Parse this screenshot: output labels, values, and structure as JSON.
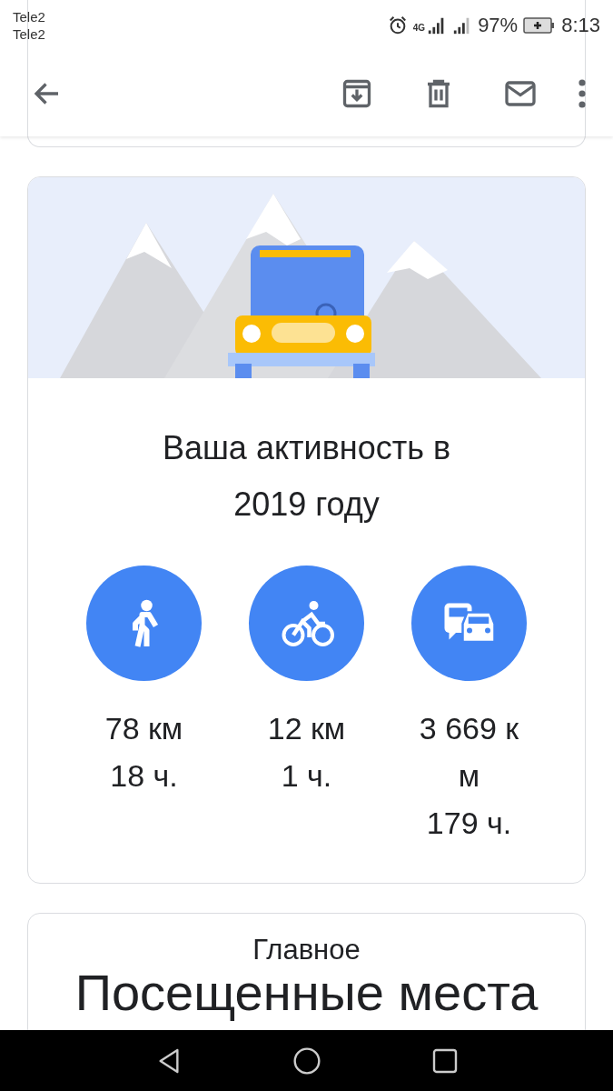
{
  "status_bar": {
    "carriers": [
      "Tele2",
      "Tele2"
    ],
    "network": "4G",
    "battery": "97%",
    "time": "8:13"
  },
  "activity_card": {
    "title": "Ваша активность в 2019 году",
    "stats": [
      {
        "kind": "walking",
        "distance": "78 км",
        "duration": "18 ч."
      },
      {
        "kind": "cycling",
        "distance": "12 км",
        "duration": "1 ч."
      },
      {
        "kind": "driving",
        "distance": "3 669 км",
        "duration": "179 ч."
      }
    ]
  },
  "highlights_card": {
    "label": "Главное",
    "title": "Посещенные места"
  }
}
